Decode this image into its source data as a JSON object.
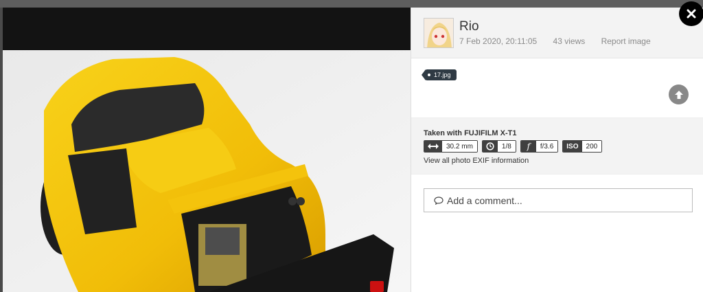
{
  "author": {
    "name": "Rio",
    "date": "7 Feb 2020, 20:11:05",
    "views": "43 views",
    "report": "Report image"
  },
  "tag": {
    "label": "17.jpg"
  },
  "exif": {
    "title": "Taken with FUJIFILM X-T1",
    "focal_length": "30.2 mm",
    "shutter": "1/8",
    "aperture_icon": "f",
    "aperture": "f/3.6",
    "iso_label": "ISO",
    "iso": "200",
    "view_all": "View all photo EXIF information"
  },
  "comment": {
    "placeholder": "Add a comment..."
  },
  "icons": {
    "close": "close-icon",
    "upvote": "arrow-up-icon",
    "focal": "focal-length-icon",
    "shutter": "shutter-icon",
    "comment": "speech-bubble-icon"
  },
  "colors": {
    "car_yellow": "#f2c40c",
    "chip_dark": "#404040",
    "panel_bg": "#f3f3f3"
  }
}
